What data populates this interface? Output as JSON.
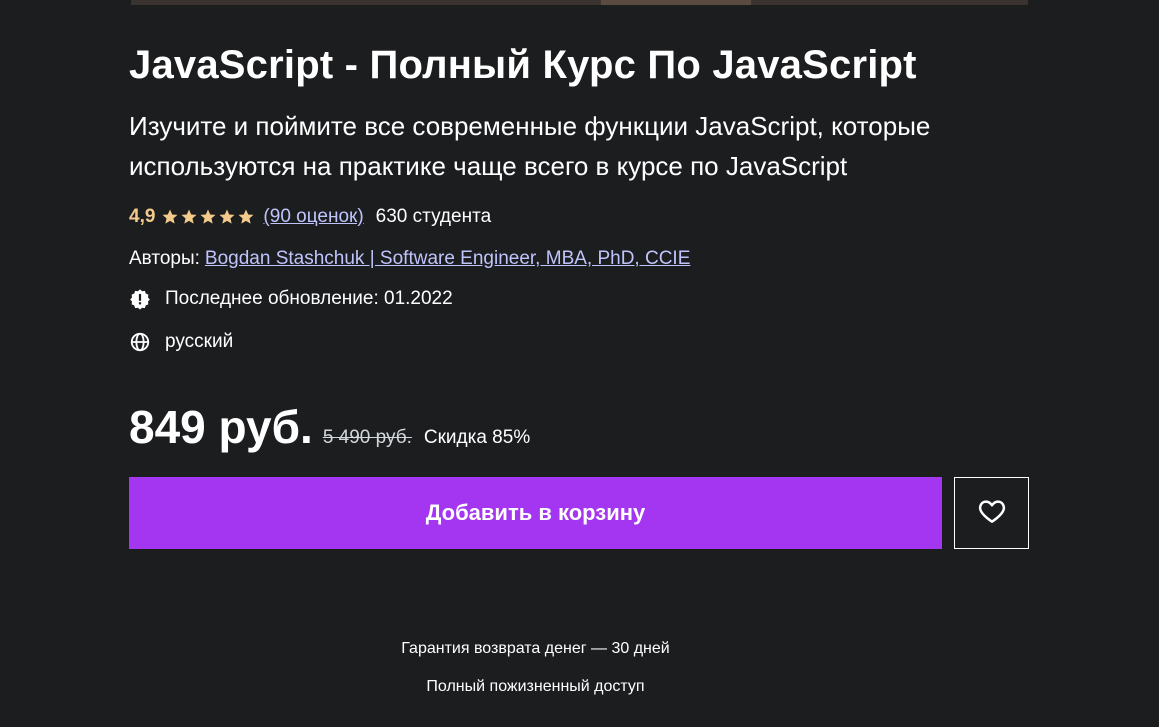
{
  "course": {
    "title": "JavaScript - Полный Курс По JavaScript",
    "subtitle": "Изучите и поймите все современные функции JavaScript, которые используются на практике чаще всего в курсе по JavaScript"
  },
  "rating": {
    "value": "4,9",
    "stars": 5,
    "ratings_link": "(90 оценок)",
    "students": "630 студента",
    "star_color": "#f3ca8c"
  },
  "authors": {
    "label": "Авторы:",
    "name": "Bogdan Stashchuk | Software Engineer, MBA, PhD, CCIE"
  },
  "meta": {
    "update_icon": "alert-badge-icon",
    "last_updated": "Последнее обновление: 01.2022",
    "language_icon": "globe-icon",
    "language": "русский"
  },
  "pricing": {
    "current": "849 руб.",
    "original": "5 490 руб.",
    "discount": "Скидка 85%"
  },
  "actions": {
    "add_to_cart": "Добавить в корзину",
    "wishlist_icon": "heart-icon",
    "accent_color": "#a435f0"
  },
  "footer": {
    "guarantee": "Гарантия возврата денег — 30 дней",
    "lifetime": "Полный пожизненный доступ"
  }
}
